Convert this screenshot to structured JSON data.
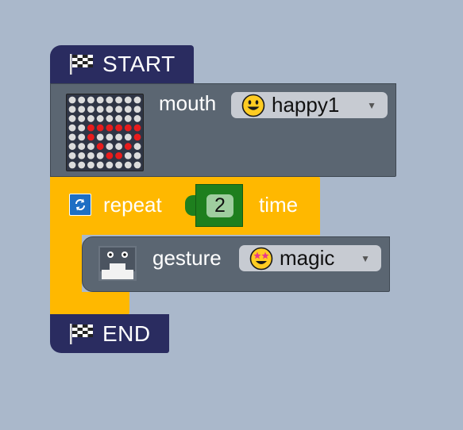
{
  "blocks": {
    "start": {
      "label": "START",
      "icon": "checkered-flag-icon"
    },
    "mouth": {
      "label": "mouth",
      "dropdown": {
        "value": "happy1",
        "icon": "smiley-face-icon"
      },
      "preview_icon": "led-matrix-icon"
    },
    "repeat": {
      "label": "repeat",
      "count": "2",
      "suffix": "time",
      "icon": "loop-icon"
    },
    "gesture": {
      "label": "gesture",
      "dropdown": {
        "value": "magic",
        "icon": "star-struck-face-icon"
      },
      "preview_icon": "robot-face-icon"
    },
    "end": {
      "label": "END",
      "icon": "checkered-flag-icon"
    }
  },
  "colors": {
    "workspace": "#aab8cb",
    "hat_block": "#2a2c60",
    "action_block": "#5b6672",
    "control_block": "#ffb800",
    "number_block": "#1e7f1e",
    "led_on": "#e81c1c",
    "led_off": "#dcdcdc"
  }
}
